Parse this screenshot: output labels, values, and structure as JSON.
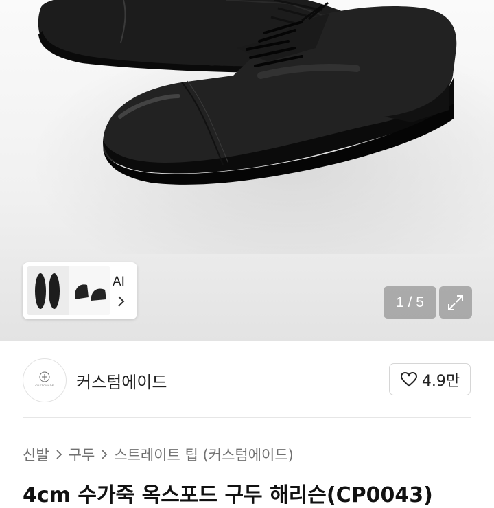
{
  "gallery": {
    "counter_text": "1 / 5",
    "ai_label": "AI",
    "icons": {
      "expand": "expand-icon",
      "next": "chevron-right-icon"
    }
  },
  "seller": {
    "name": "커스텀에이드",
    "avatar_text": "CUSTOMADE",
    "like_count": "4.9만",
    "like_icon": "heart-icon"
  },
  "breadcrumb": {
    "items": [
      "신발",
      "구두",
      "스트레이트 팁 (커스텀에이드)"
    ],
    "separator_icon": "chevron-right-icon"
  },
  "product": {
    "title": "4cm 수가죽 옥스포드 구두 해리슨(CP0043)"
  },
  "colors": {
    "text_primary": "#222222",
    "text_secondary": "#707070",
    "overlay_gray": "#8a8a8a",
    "border": "#d6d6d6"
  }
}
